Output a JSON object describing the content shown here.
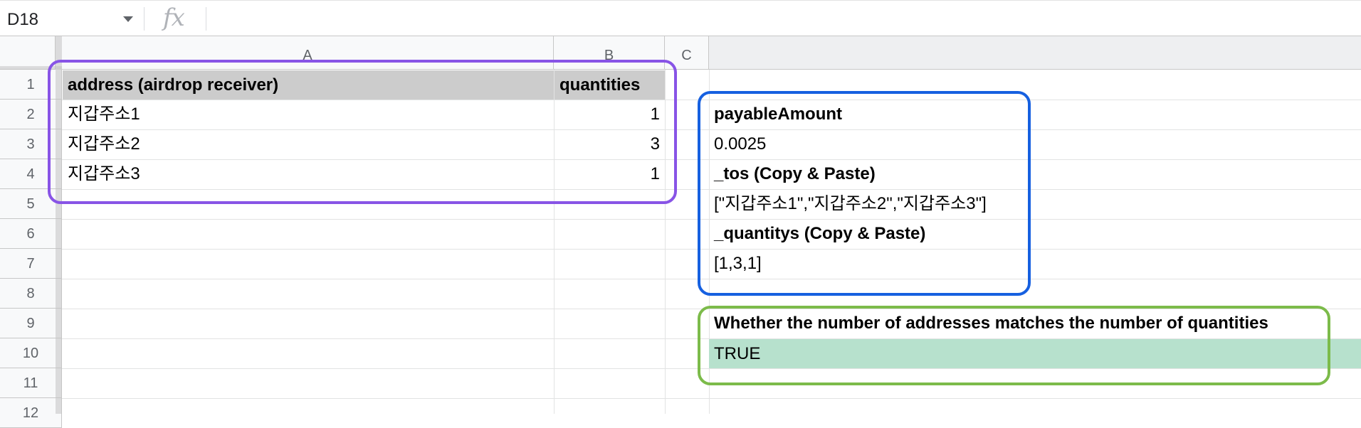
{
  "formula_bar": {
    "name_box": "D18",
    "fx_label": "fx",
    "formula": ""
  },
  "columns": [
    "A",
    "B",
    "C"
  ],
  "rows": [
    "1",
    "2",
    "3",
    "4",
    "5",
    "6",
    "7",
    "8",
    "9",
    "10",
    "11",
    "12"
  ],
  "table": {
    "headers": {
      "address": "address (airdrop receiver)",
      "quantities": "quantities"
    },
    "rows": [
      {
        "address": "지갑주소1",
        "quantity": "1"
      },
      {
        "address": "지갑주소2",
        "quantity": "3"
      },
      {
        "address": "지갑주소3",
        "quantity": "1"
      }
    ]
  },
  "params": {
    "payable_label": "payableAmount",
    "payable_value": "0.0025",
    "tos_label": "_tos (Copy & Paste)",
    "tos_value": "[\"지갑주소1\",\"지갑주소2\",\"지갑주소3\"]",
    "quantitys_label": "_quantitys (Copy & Paste)",
    "quantitys_value": "[1,3,1]"
  },
  "check": {
    "label": "Whether the number of addresses matches the number of quantities",
    "value": "TRUE"
  },
  "colors": {
    "purple_outline": "#8854e6",
    "blue_outline": "#1660e0",
    "green_outline": "#7cbb4a",
    "header_fill": "#cccccc",
    "true_fill": "#b7e1cd"
  }
}
